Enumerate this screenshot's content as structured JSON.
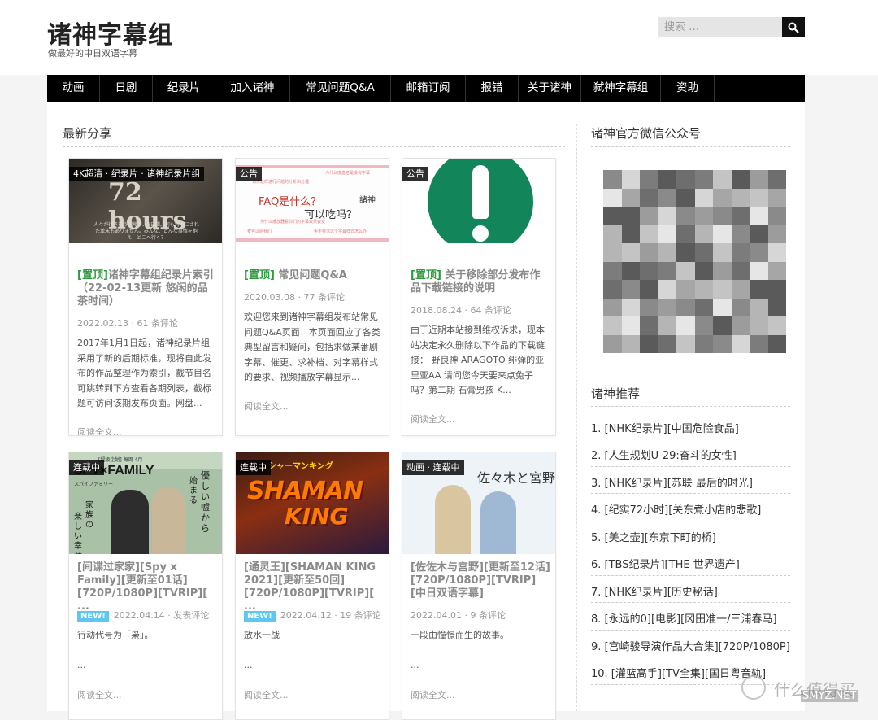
{
  "site": {
    "title": "诸神字幕组",
    "description": "做最好的中日双语字幕"
  },
  "search": {
    "placeholder": "搜索 …"
  },
  "nav": [
    "动画",
    "日剧",
    "纪录片",
    "加入诸神",
    "常见问题Q&A",
    "邮箱订阅",
    "报错",
    "关于诸神",
    "弑神字幕组",
    "资助"
  ],
  "main": {
    "section_title": "最新分享",
    "posts": [
      {
        "badge": "4K超清 · 纪录片 · 诸神纪录片组",
        "pin": "[置顶]",
        "title": "诸神字幕组纪录片索引（22-02-13更新 悠闲的品茶时间）",
        "new": "",
        "date": "2022.02.13",
        "comments": "61 条评论",
        "excerpt": "2017年1月1日起，诸神纪录片组采用了新的后期标准，现将自此发布的作品整理作为索引，截节目名可跳转到下方查看各期列表，截标题可访问该期发布页面。网盘...",
        "readmore": "阅读全文..."
      },
      {
        "badge": "公告",
        "pin": "[置顶]",
        "title": "常见问题Q&A",
        "new": "",
        "date": "2020.03.08",
        "comments": "77 条评论",
        "excerpt": "欢迎您来到诸神字幕组发布站常见问题Q&A页面！本页面回应了各类典型留言和疑问，包括求做某番剧字幕、催更、求补档、对字幕样式的要求、视频播放字幕显示...",
        "readmore": "阅读全文..."
      },
      {
        "badge": "公告",
        "pin": "[置顶]",
        "title": "关于移除部分发布作品下载链接的说明",
        "new": "",
        "date": "2018.08.24",
        "comments": "64 条评论",
        "excerpt": "由于近期本站接到维权诉求，现本站决定永久删除以下作品的下载链接： 野良神 ARAGOTO 绯弹的亚里亚AA 请问您今天要来点兔子吗？第二期 石膏男孩 K...",
        "readmore": "阅读全文..."
      },
      {
        "badge": "连载中",
        "pin": "",
        "title": "[间谍过家家][Spy x Family][更新至01话][720P/1080P][TVRIP][ ...",
        "new": "NEW!",
        "date": "2022.04.14",
        "comments": "发表评论",
        "excerpt": "行动代号为「枭」。\n\n...",
        "readmore": "阅读全文..."
      },
      {
        "badge": "连载中",
        "pin": "",
        "title": "[通灵王][SHAMAN KING 2021][更新至50回][720P/1080P][TVRIP][ ...",
        "new": "NEW!",
        "date": "2022.04.12",
        "comments": "19 条评论",
        "excerpt": "放水一战\n\n...",
        "readmore": "阅读全文..."
      },
      {
        "badge": "动画 · 连载中",
        "pin": "",
        "title": "[佐佐木与宫野][更新至12话][720P/1080P][TVRIP][中日双语字幕]",
        "new": "",
        "date": "2022.04.01",
        "comments": "9 条评论",
        "excerpt": "一段由憧憬而生的故事。\n\n...",
        "readmore": "阅读全文..."
      }
    ],
    "thumb_text": {
      "doc_big": "72 hours",
      "doc_caption": "人々が行き交う場所で、3日間。何も特別にされた並末もありません。みんな、どんな事情を抱え、どこへ行く？",
      "faq_big1": "FAQ是什么？",
      "faq_big2": "可以吃吗？",
      "faq_logo": "諸神",
      "faq_small1": "请你这样进行问题的分析和处理",
      "faq_small2": "为什么度盘老是没有字幕",
      "faq_small3": "为什么播放器看你们的字幕效果会变",
      "faq_small4": "麦可以给我们",
      "faq_small5": "免不要求这个字幕样式怎么办",
      "spy_logo": "SPY×FAMILY",
      "spy_sub": "スパイファミリー",
      "spy_top": "[超级企划] 每周 4月",
      "spy_v1": "優しい嘘から",
      "spy_v2": "始まる",
      "spy_v3": "家族の",
      "spy_v4": "楽しい幸せ",
      "shaman_logo1": "SHAMAN",
      "shaman_logo2": "KING",
      "shaman_kana": "シャーマンキング",
      "sasaki_title": "佐々木と宮野"
    }
  },
  "sidebar": {
    "wechat_title": "诸神官方微信公众号",
    "rec_title": "诸神推荐",
    "items": [
      "1. [NHK纪录片][中国危险食品]",
      "2. [人生规划U-29:奋斗的女性]",
      "3. [NHK纪录片][苏联 最后的时光]",
      "4. [纪实72小时][关东煮小店的悲歌]",
      "5. [美之壶][东京下町的桥]",
      "6. [TBS纪录片][THE 世界遗产]",
      "7. [NHK纪录片][历史秘话]",
      "8. [永远的0][电影][冈田准一/三浦春马]",
      "9. [宫崎骏导演作品大合集][720P/1080P]",
      "10. [灌篮高手][TV全集][国日粤音轨]"
    ]
  },
  "watermark": {
    "brand": "什么值得买",
    "site": "SMYZ.NET"
  },
  "colors": {
    "nav_bg": "#000000",
    "pin_green": "#2e9a3e",
    "new_badge": "#5cc8f0",
    "bang_green": "#12855a"
  }
}
